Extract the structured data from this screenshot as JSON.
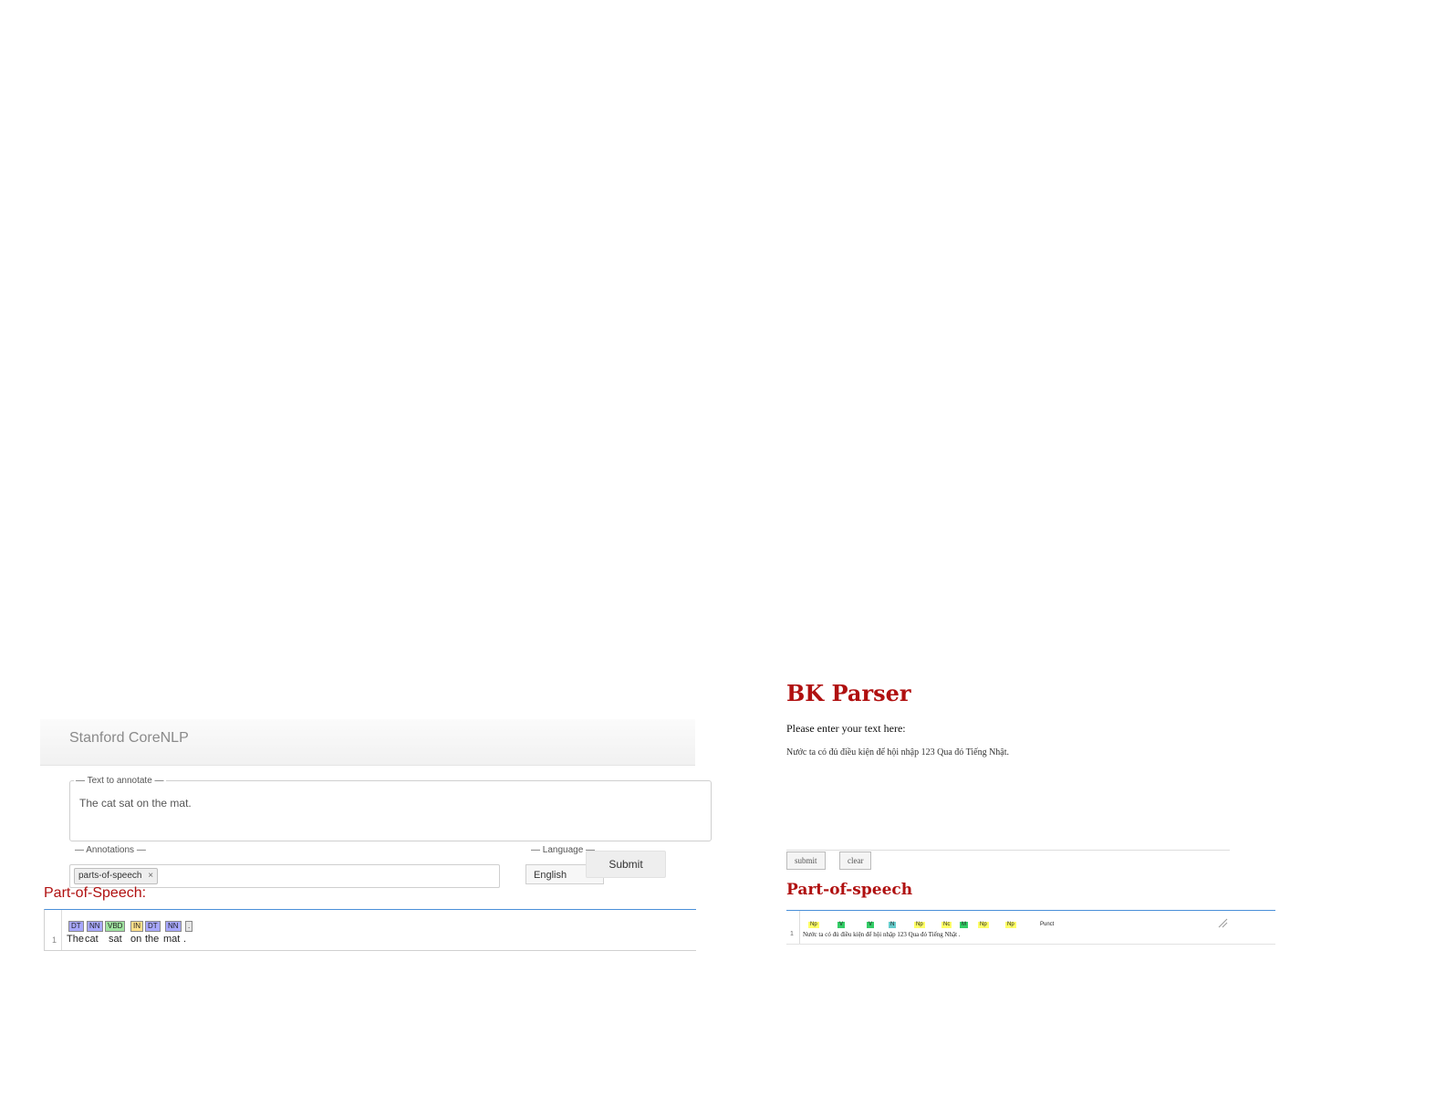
{
  "stanford": {
    "brand": "Stanford CoreNLP",
    "text_legend": "— Text to annotate —",
    "text_value": "The cat sat on the mat.",
    "annotations_legend": "— Annotations —",
    "annotation_chip": "parts-of-speech",
    "annotation_chip_remove": "×",
    "language_legend": "— Language —",
    "language_value": "English",
    "submit_label": "Submit",
    "pos_heading": "Part-of-Speech:",
    "line_number": "1",
    "tags": [
      {
        "label": "DT",
        "color": "#a8a8ff"
      },
      {
        "label": "NN",
        "color": "#a8a8ff"
      },
      {
        "label": "VBD",
        "color": "#9fe29f"
      },
      {
        "label": "IN",
        "color": "#ffe08a"
      },
      {
        "label": "DT",
        "color": "#a8a8ff"
      },
      {
        "label": "NN",
        "color": "#a8a8ff"
      },
      {
        "label": ".",
        "color": "#e6e6e6"
      }
    ],
    "words": [
      "The",
      "cat",
      "sat",
      "on",
      "the",
      "mat",
      "."
    ]
  },
  "bk": {
    "title": "BK Parser",
    "prompt": "Please enter your text here:",
    "sample": "Nước ta có đủ điều kiện để hội nhập 123 Qua đó Tiếng Nhật.",
    "submit_label": "submit",
    "clear_label": "clear",
    "pos_heading": "Part-of-speech",
    "line_number": "1",
    "tags": [
      {
        "label": "Np",
        "color": "#ffff66"
      },
      {
        "label": "V",
        "color": "#33cc66"
      },
      {
        "label": "V",
        "color": "#33cc66"
      },
      {
        "label": "N",
        "color": "#66cccc"
      },
      {
        "label": "Np",
        "color": "#ffff66"
      },
      {
        "label": "Nc",
        "color": "#ffff66"
      },
      {
        "label": "M",
        "color": "#33cc66"
      },
      {
        "label": "Np",
        "color": "#ffff66"
      },
      {
        "label": "Np",
        "color": "#ffff66"
      },
      {
        "label": "Punct",
        "color": "#ffffff"
      }
    ],
    "words_line": "Nước ta có đủ điều kiện để hội nhập 123 Qua đó Tiếng Nhật ."
  }
}
